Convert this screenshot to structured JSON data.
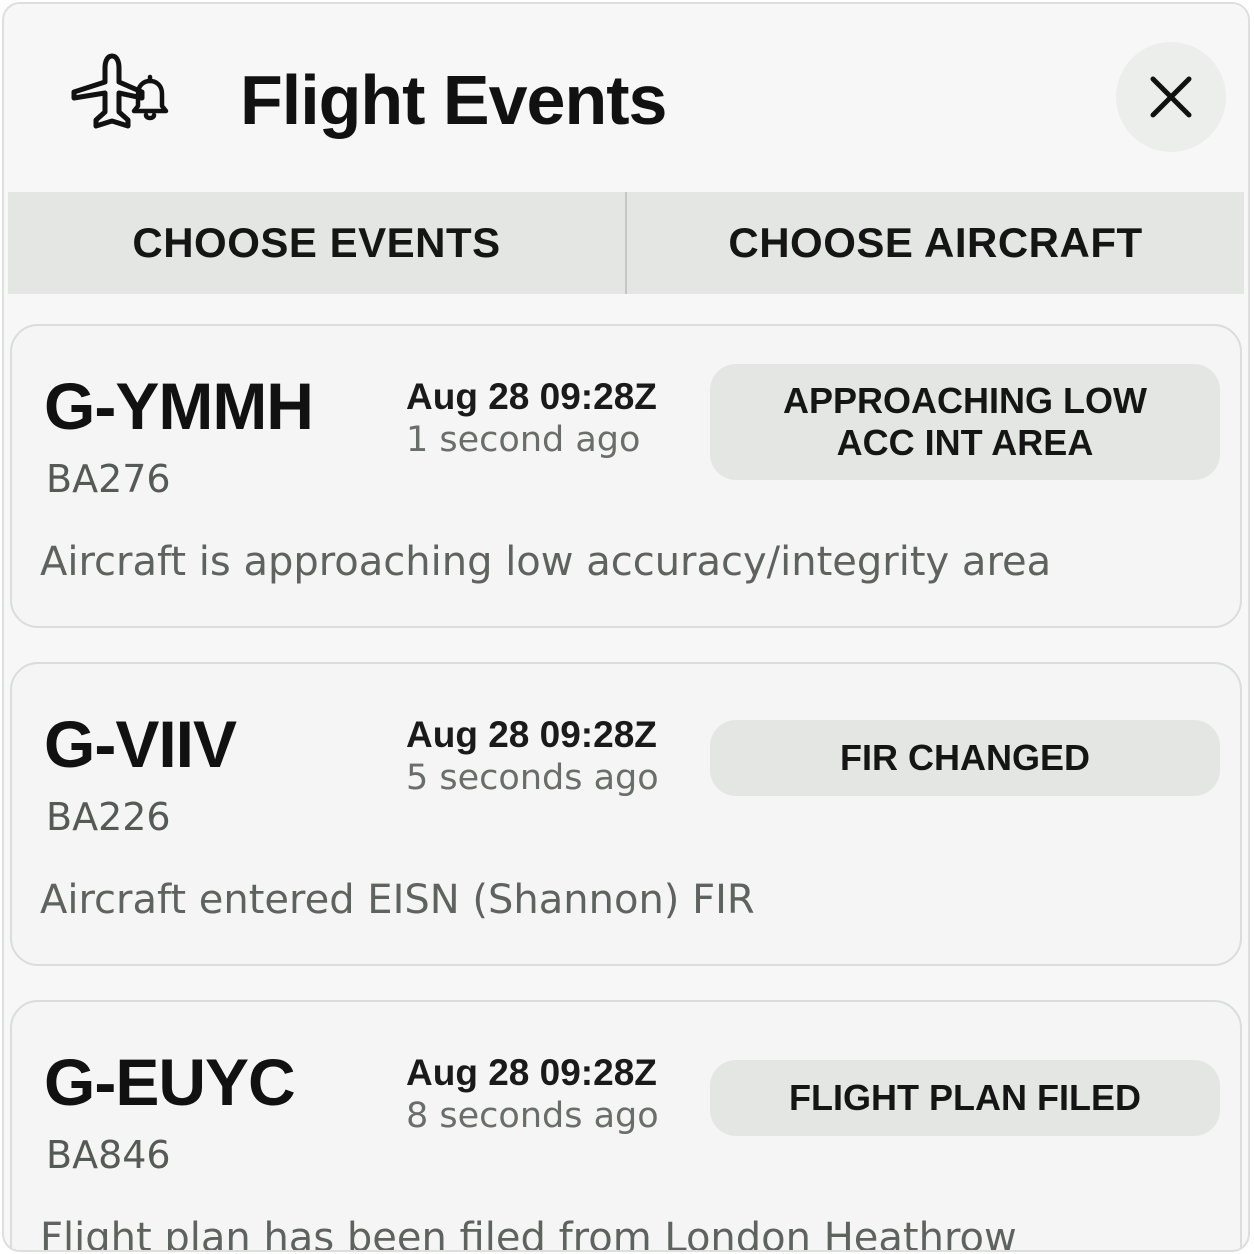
{
  "header": {
    "title": "Flight Events",
    "icon": "plane-bell-icon",
    "close_icon": "close-icon"
  },
  "tabs": [
    {
      "label": "CHOOSE EVENTS"
    },
    {
      "label": "CHOOSE AIRCRAFT"
    }
  ],
  "events": [
    {
      "registration": "G-YMMH",
      "flight": "BA276",
      "time": "Aug 28 09:28Z",
      "ago": "1 second ago",
      "badge": "APPROACHING LOW ACC INT AREA",
      "description": "Aircraft is approaching low accuracy/integrity area"
    },
    {
      "registration": "G-VIIV",
      "flight": "BA226",
      "time": "Aug 28 09:28Z",
      "ago": "5 seconds ago",
      "badge": "FIR CHANGED",
      "description": "Aircraft entered EISN (Shannon) FIR"
    },
    {
      "registration": "G-EUYC",
      "flight": "BA846",
      "time": "Aug 28 09:28Z",
      "ago": "8 seconds ago",
      "badge": "FLIGHT PLAN FILED",
      "description": "Flight plan has been filed from London Heathrow"
    }
  ],
  "colors": {
    "panel_bg": "#f6f7f6",
    "tab_bg": "#e3e6e3",
    "badge_bg": "#e3e6e3",
    "text_primary": "#111111",
    "text_secondary": "#5e6360"
  }
}
